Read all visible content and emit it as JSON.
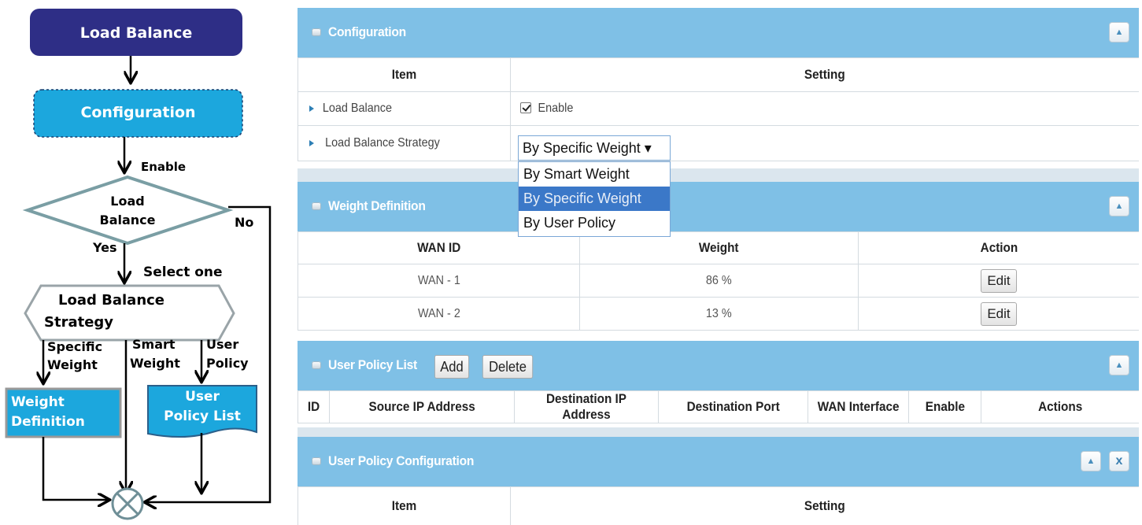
{
  "flowchart": {
    "nodes": {
      "load_balance": "Load Balance",
      "configuration": "Configuration",
      "decision_line1": "Load",
      "decision_line2": "Balance",
      "strategy_line1": "Load Balance",
      "strategy_line2": "Strategy",
      "weight_definition_line1": "Weight",
      "weight_definition_line2": "Definition",
      "user_policy_list_line1": "User",
      "user_policy_list_line2": "Policy List"
    },
    "labels": {
      "enable": "Enable",
      "yes": "Yes",
      "no": "No",
      "select_one": "Select one",
      "specific_weight_line1": "Specific",
      "specific_weight_line2": "Weight",
      "smart_weight_line1": "Smart",
      "smart_weight_line2": "Weight",
      "user_policy_line1": "User",
      "user_policy_line2": "Policy"
    },
    "colors": {
      "load_balance_node": "#2e2e86",
      "configuration_node": "#1ca7dd",
      "decision_stroke": "#7a9ea4",
      "weight_definition_node": "#1ca7dd",
      "user_policy_list_node": "#1ca7dd"
    }
  },
  "configuration": {
    "title": "Configuration",
    "col_item": "Item",
    "col_setting": "Setting",
    "rows": [
      {
        "label": "Load Balance",
        "checkbox_label": "Enable",
        "checked": true
      },
      {
        "label": "Load Balance Strategy",
        "selected": "By Specific Weight ▾"
      }
    ],
    "strategy_options": [
      "By Smart Weight",
      "By Specific Weight",
      "By User Policy"
    ],
    "highlighted_option": "By Specific Weight"
  },
  "weight_definition": {
    "title": "Weight Definition",
    "columns": [
      "WAN ID",
      "Weight",
      "Action"
    ],
    "rows": [
      {
        "wan_id": "WAN - 1",
        "weight": "86 %",
        "action": "Edit"
      },
      {
        "wan_id": "WAN - 2",
        "weight": "13 %",
        "action": "Edit"
      }
    ]
  },
  "user_policy_list": {
    "title": "User Policy List",
    "add_label": "Add",
    "delete_label": "Delete",
    "columns": [
      "ID",
      "Source IP Address",
      "Destination IP Address",
      "Destination Port",
      "WAN Interface",
      "Enable",
      "Actions"
    ]
  },
  "user_policy_configuration": {
    "title": "User Policy Configuration",
    "col_item": "Item",
    "col_setting": "Setting",
    "close_label": "x"
  },
  "icons": {
    "collapse": "collapse-icon",
    "close": "close-icon",
    "panel_bullet": "panel-bullet-icon",
    "row_arrow": "row-arrow-icon"
  },
  "ui_colors": {
    "panel_header": "#7fc0e6",
    "selected_option": "#3b78c8",
    "panel_gap": "#dbe6ee"
  }
}
